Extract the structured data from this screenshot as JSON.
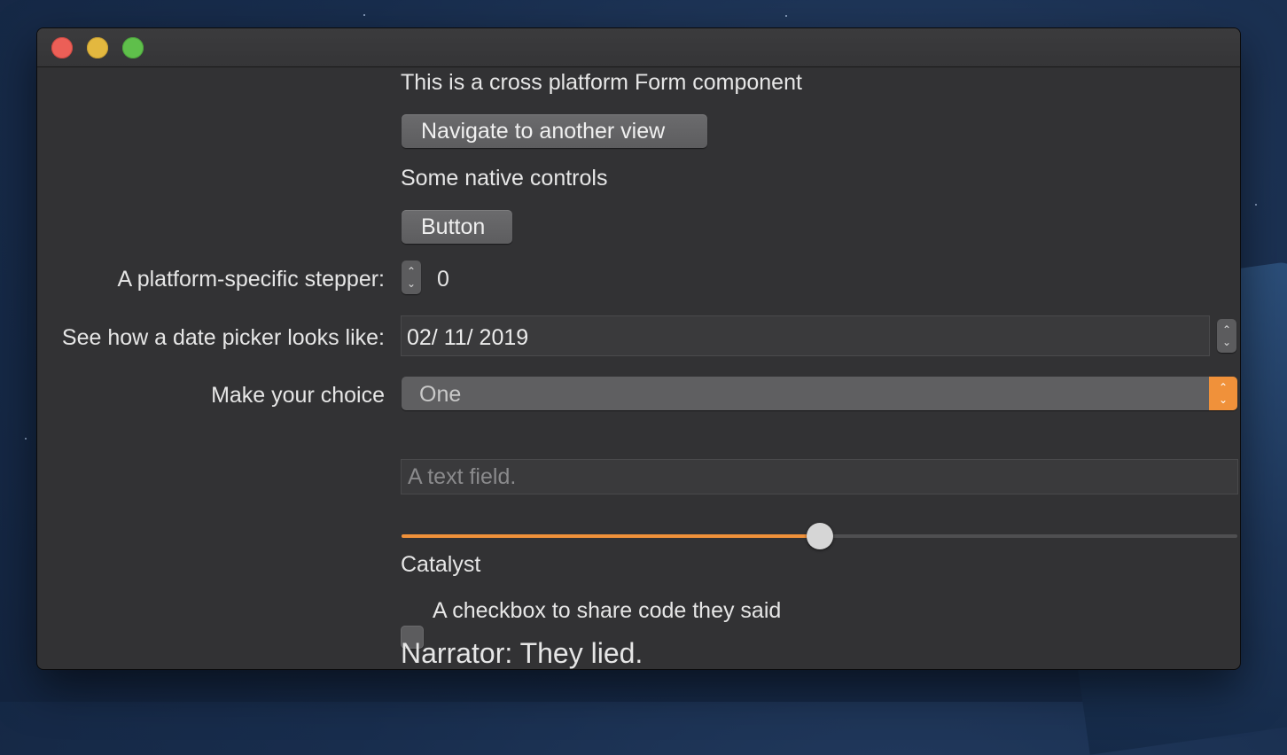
{
  "form": {
    "header_text": "This is a cross platform Form component",
    "navigate_button_label": "Navigate to another view",
    "native_controls_text": "Some native controls",
    "button_label": "Button",
    "stepper_label": "A platform-specific stepper:",
    "stepper_value": "0",
    "date_picker_label": "See how a date picker looks like:",
    "date_value": "02/ 11/ 2019",
    "choice_label": "Make your choice",
    "choice_selected": "One",
    "text_field_placeholder": "A text field.",
    "slider_value_fraction": 0.5,
    "catalyst_text": "Catalyst",
    "checkbox_label": "A checkbox to share code they said",
    "narrator_text": "Narrator: They lied."
  },
  "colors": {
    "accent": "#f0913a",
    "window_bg": "#323234"
  },
  "icons": {
    "window_controls": [
      "close-icon",
      "minimize-icon",
      "zoom-icon"
    ],
    "stepper": "up-down-arrows-icon"
  }
}
